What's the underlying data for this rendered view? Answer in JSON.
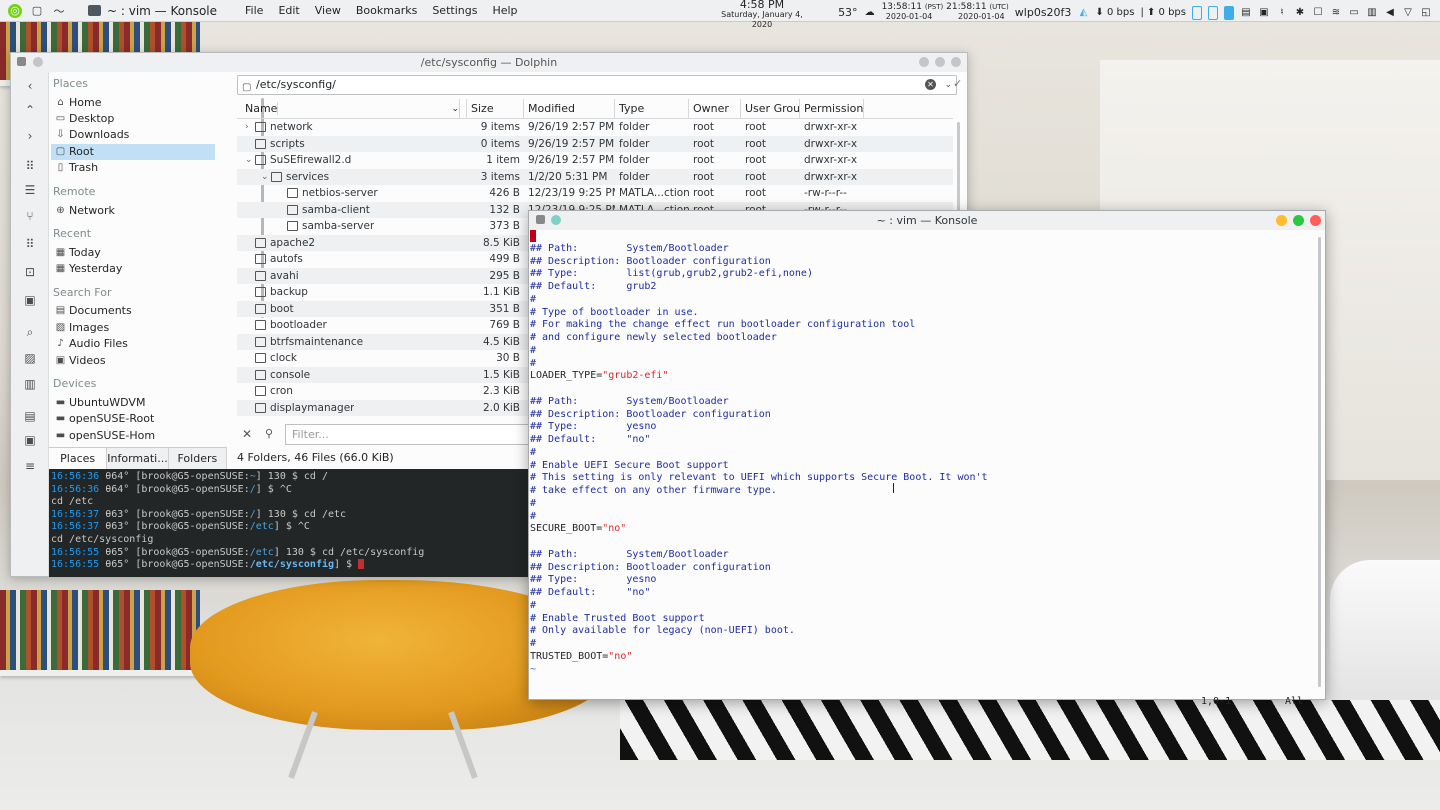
{
  "panel": {
    "active_app": "~ : vim — Konsole",
    "menu": [
      "File",
      "Edit",
      "View",
      "Bookmarks",
      "Settings",
      "Help"
    ],
    "clock_time": "4:58 PM",
    "clock_date": "Saturday, January 4, 2020",
    "weather": "53°",
    "pst_time": "13:58:11",
    "pst_label": "(PST)",
    "pst_date": "2020-01-04",
    "utc_time": "21:58:11",
    "utc_label": "(UTC)",
    "utc_date": "2020-01-04",
    "network_iface": "wlp0s20f3",
    "down_rate": "0 bps",
    "up_rate": "0 bps"
  },
  "dolphin": {
    "title": "/etc/sysconfig — Dolphin",
    "path": "/etc/sysconfig/",
    "filter_placeholder": "Filter...",
    "status": "4 Folders, 46 Files (66.0 KiB)",
    "places_tabs": [
      "Places",
      "Informati...",
      "Folders"
    ],
    "sections": {
      "places": "Places",
      "remote": "Remote",
      "recent": "Recent",
      "search": "Search For",
      "devices": "Devices"
    },
    "places_items": [
      {
        "label": "Home",
        "icon": "home-icon"
      },
      {
        "label": "Desktop",
        "icon": "desktop-icon"
      },
      {
        "label": "Downloads",
        "icon": "downloads-icon"
      },
      {
        "label": "Root",
        "icon": "root-folder-icon"
      },
      {
        "label": "Trash",
        "icon": "trash-icon"
      }
    ],
    "remote_items": [
      {
        "label": "Network",
        "icon": "network-icon"
      }
    ],
    "recent_items": [
      {
        "label": "Today",
        "icon": "calendar-icon"
      },
      {
        "label": "Yesterday",
        "icon": "calendar-icon"
      }
    ],
    "search_items": [
      {
        "label": "Documents",
        "icon": "document-icon"
      },
      {
        "label": "Images",
        "icon": "image-icon"
      },
      {
        "label": "Audio Files",
        "icon": "audio-icon"
      },
      {
        "label": "Videos",
        "icon": "video-icon"
      }
    ],
    "device_items": [
      {
        "label": "UbuntuWDVM",
        "icon": "drive-icon"
      },
      {
        "label": "openSUSE-Root",
        "icon": "drive-icon"
      },
      {
        "label": "openSUSE-Hom",
        "icon": "drive-icon"
      }
    ],
    "columns": [
      "Name",
      "Size",
      "Modified",
      "Type",
      "Owner",
      "User Group",
      "Permission"
    ],
    "files": [
      {
        "name": "network",
        "size": "9 items",
        "modified": "9/26/19 2:57 PM",
        "type": "folder",
        "owner": "root",
        "group": "root",
        "perm": "drwxr-xr-x"
      },
      {
        "name": "scripts",
        "size": "0 items",
        "modified": "9/26/19 2:57 PM",
        "type": "folder",
        "owner": "root",
        "group": "root",
        "perm": "drwxr-xr-x"
      },
      {
        "name": "SuSEfirewall2.d",
        "size": "1 item",
        "modified": "9/26/19 2:57 PM",
        "type": "folder",
        "owner": "root",
        "group": "root",
        "perm": "drwxr-xr-x"
      },
      {
        "name": "services",
        "size": "3 items",
        "modified": "1/2/20 5:31 PM",
        "type": "folder",
        "owner": "root",
        "group": "root",
        "perm": "drwxr-xr-x"
      },
      {
        "name": "netbios-server",
        "size": "426 B",
        "modified": "12/23/19 9:25 PM",
        "type": "MATLA...ction",
        "owner": "root",
        "group": "root",
        "perm": "-rw-r--r--"
      },
      {
        "name": "samba-client",
        "size": "132 B",
        "modified": "12/23/19 9:25 PM",
        "type": "MATLA...ction",
        "owner": "root",
        "group": "root",
        "perm": "-rw-r--r--"
      },
      {
        "name": "samba-server",
        "size": "373 B",
        "modified": "",
        "type": "",
        "owner": "",
        "group": "",
        "perm": ""
      },
      {
        "name": "apache2",
        "size": "8.5 KiB",
        "modified": "",
        "type": "",
        "owner": "",
        "group": "",
        "perm": ""
      },
      {
        "name": "autofs",
        "size": "499 B",
        "modified": "",
        "type": "",
        "owner": "",
        "group": "",
        "perm": ""
      },
      {
        "name": "avahi",
        "size": "295 B",
        "modified": "",
        "type": "",
        "owner": "",
        "group": "",
        "perm": ""
      },
      {
        "name": "backup",
        "size": "1.1 KiB",
        "modified": "",
        "type": "",
        "owner": "",
        "group": "",
        "perm": ""
      },
      {
        "name": "boot",
        "size": "351 B",
        "modified": "",
        "type": "",
        "owner": "",
        "group": "",
        "perm": ""
      },
      {
        "name": "bootloader",
        "size": "769 B",
        "modified": "",
        "type": "",
        "owner": "",
        "group": "",
        "perm": ""
      },
      {
        "name": "btrfsmaintenance",
        "size": "4.5 KiB",
        "modified": "",
        "type": "",
        "owner": "",
        "group": "",
        "perm": ""
      },
      {
        "name": "clock",
        "size": "30 B",
        "modified": "",
        "type": "",
        "owner": "",
        "group": "",
        "perm": ""
      },
      {
        "name": "console",
        "size": "1.5 KiB",
        "modified": "",
        "type": "",
        "owner": "",
        "group": "",
        "perm": ""
      },
      {
        "name": "cron",
        "size": "2.3 KiB",
        "modified": "",
        "type": "",
        "owner": "",
        "group": "",
        "perm": ""
      },
      {
        "name": "displaymanager",
        "size": "2.0 KiB",
        "modified": "",
        "type": "",
        "owner": "",
        "group": "",
        "perm": ""
      }
    ],
    "terminal_lines": [
      {
        "time": "16:56:36",
        "temp": "θ64°",
        "user": "[brook@G5-openSUSE:",
        "dir": "~",
        "tail": "] 130 $  cd /"
      },
      {
        "time": "16:56:36",
        "temp": "θ64°",
        "user": "[brook@G5-openSUSE:",
        "dir": "/",
        "tail": "] $ ^C"
      },
      {
        "plain": " cd /etc"
      },
      {
        "time": "16:56:37",
        "temp": "θ63°",
        "user": "[brook@G5-openSUSE:",
        "dir": "/",
        "tail": "] 130 $  cd /etc"
      },
      {
        "time": "16:56:37",
        "temp": "θ63°",
        "user": "[brook@G5-openSUSE:",
        "dir": "/etc",
        "tail": "] $ ^C"
      },
      {
        "plain": " cd /etc/sysconfig"
      },
      {
        "time": "16:56:55",
        "temp": "θ65°",
        "user": "[brook@G5-openSUSE:",
        "dir": "/etc",
        "tail": "] 130 $  cd /etc/sysconfig"
      },
      {
        "time": "16:56:55",
        "temp": "θ65°",
        "user": "[brook@G5-openSUSE:",
        "dir": "/etc/sysconfig",
        "tail": "] $ "
      }
    ]
  },
  "konsole": {
    "title": "~ : vim — Konsole",
    "lines": [
      {
        "t": "cursor"
      },
      {
        "t": "c",
        "text": "## Path:        System/Bootloader"
      },
      {
        "t": "c",
        "text": "## Description: Bootloader configuration"
      },
      {
        "t": "c",
        "text": "## Type:        list(grub,grub2,grub2-efi,none)"
      },
      {
        "t": "c",
        "text": "## Default:     grub2"
      },
      {
        "t": "c",
        "text": "#"
      },
      {
        "t": "c",
        "text": "# Type of bootloader in use."
      },
      {
        "t": "c",
        "text": "# For making the change effect run bootloader configuration tool"
      },
      {
        "t": "c",
        "text": "# and configure newly selected bootloader"
      },
      {
        "t": "c",
        "text": "#"
      },
      {
        "t": "c",
        "text": "#"
      },
      {
        "t": "kv",
        "key": "LOADER_TYPE=",
        "val": "\"grub2-efi\""
      },
      {
        "t": "c",
        "text": ""
      },
      {
        "t": "c",
        "text": "## Path:        System/Bootloader"
      },
      {
        "t": "c",
        "text": "## Description: Bootloader configuration"
      },
      {
        "t": "c",
        "text": "## Type:        yesno"
      },
      {
        "t": "c",
        "text": "## Default:     \"no\""
      },
      {
        "t": "c",
        "text": "#"
      },
      {
        "t": "c",
        "text": "# Enable UEFI Secure Boot support"
      },
      {
        "t": "c",
        "text": "# This setting is only relevant to UEFI which supports Secure Boot. It won't"
      },
      {
        "t": "c",
        "text": "# take effect on any other firmware type."
      },
      {
        "t": "c",
        "text": "#"
      },
      {
        "t": "c",
        "text": "#"
      },
      {
        "t": "kv",
        "key": "SECURE_BOOT=",
        "val": "\"no\""
      },
      {
        "t": "c",
        "text": ""
      },
      {
        "t": "c",
        "text": "## Path:        System/Bootloader"
      },
      {
        "t": "c",
        "text": "## Description: Bootloader configuration"
      },
      {
        "t": "c",
        "text": "## Type:        yesno"
      },
      {
        "t": "c",
        "text": "## Default:     \"no\""
      },
      {
        "t": "c",
        "text": "#"
      },
      {
        "t": "c",
        "text": "# Enable Trusted Boot support"
      },
      {
        "t": "c",
        "text": "# Only available for legacy (non-UEFI) boot."
      },
      {
        "t": "c",
        "text": "#"
      },
      {
        "t": "kv",
        "key": "TRUSTED_BOOT=",
        "val": "\"no\""
      },
      {
        "t": "tilde",
        "text": "~"
      }
    ],
    "status_pos": "1,0-1",
    "status_all": "All"
  },
  "colors": {
    "accent": "#3daee9",
    "selection": "#c2e0f5",
    "vim_comment": "#1f2d9e",
    "vim_string": "#d9262e",
    "close": "#ff5f57",
    "minimize": "#febc2e",
    "maximize": "#28c840"
  }
}
